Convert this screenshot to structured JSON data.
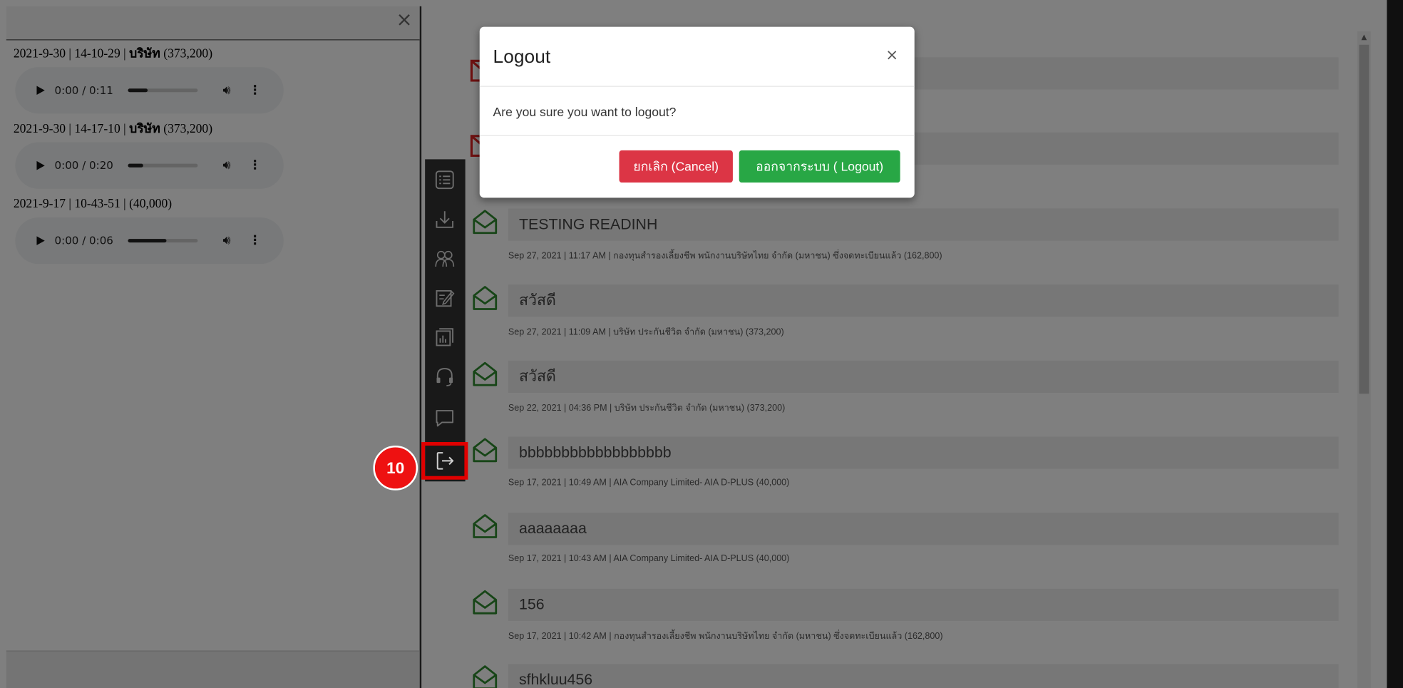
{
  "recordings": [
    {
      "label_prefix": "2021-9-30 | 14-10-29 | ",
      "label_bold": "บริษัท",
      "label_suffix": " (373,200)",
      "time": "0:00 / 0:11",
      "progress": 0.28
    },
    {
      "label_prefix": "2021-9-30 | 14-17-10 | ",
      "label_bold": "บริษัท",
      "label_suffix": " (373,200)",
      "time": "0:00 / 0:20",
      "progress": 0.22
    },
    {
      "label_prefix": "2021-9-17 | 10-43-51 | ",
      "label_bold": "",
      "label_suffix": "(40,000)",
      "time": "0:00 / 0:06",
      "progress": 0.55
    }
  ],
  "messages": [
    {
      "subject": "",
      "meta": ""
    },
    {
      "subject": "",
      "meta": ""
    },
    {
      "subject": "TESTING READINH",
      "meta": "Sep 27, 2021 | 11:17 AM | กองทุนสำรองเลี้ยงชีพ พนักงานบริษัทไทย จำกัด (มหาชน) ซึ่งจดทะเบียนแล้ว (162,800)"
    },
    {
      "subject": "สวัสดี",
      "meta": "Sep 27, 2021 | 11:09 AM | บริษัท ประกันชีวิต จำกัด (มหาชน) (373,200)"
    },
    {
      "subject": "สวัสดี",
      "meta": "Sep 22, 2021 | 04:36 PM | บริษัท ประกันชีวิต จำกัด (มหาชน) (373,200)"
    },
    {
      "subject": "bbbbbbbbbbbbbbbbbb",
      "meta": "Sep 17, 2021 | 10:49 AM | AIA Company Limited- AIA D-PLUS (40,000)"
    },
    {
      "subject": "aaaaaaaa",
      "meta": "Sep 17, 2021 | 10:43 AM | AIA Company Limited- AIA D-PLUS (40,000)"
    },
    {
      "subject": "156",
      "meta": "Sep 17, 2021 | 10:42 AM | กองทุนสำรองเลี้ยงชีพ พนักงานบริษัทไทย จำกัด (มหาชน) ซึ่งจดทะเบียนแล้ว (162,800)"
    },
    {
      "subject": "sfhkluu456",
      "meta": ""
    }
  ],
  "modal": {
    "title": "Logout",
    "close": "×",
    "body": "Are you sure you want to logout?",
    "cancel_label": "ยกเลิก (Cancel)",
    "logout_label": "ออกจากระบบ ( Logout)"
  },
  "annotation": {
    "step": "10"
  },
  "left_close": "×",
  "colors": {
    "overlay": "#000000",
    "cancel": "#dc3545",
    "logout": "#28a745",
    "envelope": "#2e8b2e",
    "highlight": "#e00000"
  },
  "sidebar_icons": [
    "list-icon",
    "download-icon",
    "users-icon",
    "edit-document-icon",
    "report-icon",
    "headset-icon",
    "chat-icon",
    "logout-icon"
  ]
}
